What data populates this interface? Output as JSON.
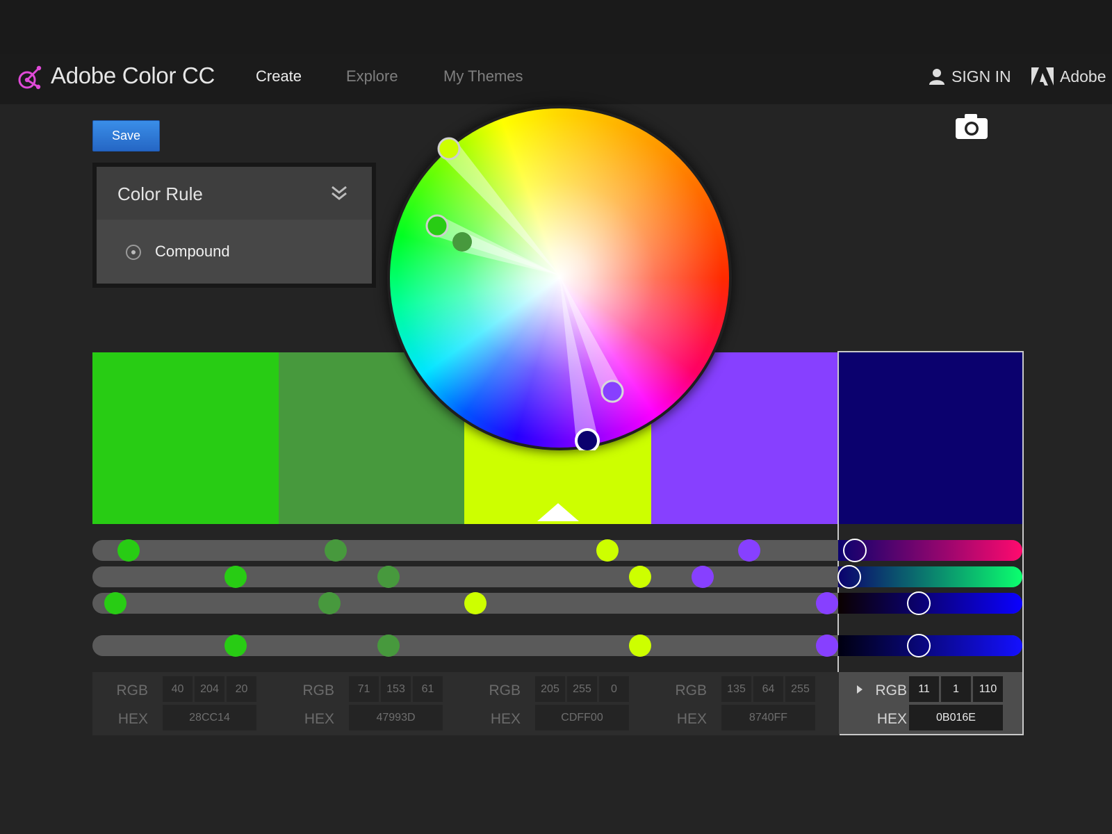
{
  "app": {
    "brand": "Adobe Color CC"
  },
  "nav": {
    "create": "Create",
    "explore": "Explore",
    "my_themes": "My Themes",
    "sign_in": "SIGN IN",
    "adobe": "Adobe"
  },
  "toolbar": {
    "save_label": "Save"
  },
  "color_rule": {
    "title": "Color Rule",
    "selected": "Compound"
  },
  "icons": {
    "logo": "adobe-color-logo-icon",
    "user": "user-icon",
    "adobe": "adobe-logo-icon",
    "camera": "camera-icon",
    "chevron": "double-chevron-down-icon",
    "radio": "radio-icon",
    "expand": "expand-triangle-icon"
  },
  "colors": {
    "accent": "#2b7ad9",
    "background": "#242424",
    "navbar": "#1b1b1b"
  },
  "swatches": [
    {
      "hex": "28CC14",
      "rgb": [
        "40",
        "204",
        "20"
      ],
      "color": "#28CC14"
    },
    {
      "hex": "47993D",
      "rgb": [
        "71",
        "153",
        "61"
      ],
      "color": "#47993D"
    },
    {
      "hex": "CDFF00",
      "rgb": [
        "205",
        "255",
        "0"
      ],
      "color": "#CDFF00"
    },
    {
      "hex": "8740FF",
      "rgb": [
        "135",
        "64",
        "255"
      ],
      "color": "#8740FF"
    },
    {
      "hex": "0B016E",
      "rgb": [
        "11",
        "1",
        "110"
      ],
      "color": "#0B016E"
    }
  ],
  "active_swatch": 4,
  "readout_labels": {
    "rgb": "RGB",
    "hex": "HEX"
  }
}
